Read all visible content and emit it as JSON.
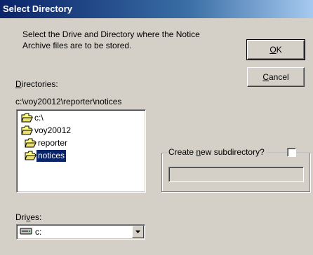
{
  "window": {
    "title": "Select Directory"
  },
  "instructions": {
    "line1": "Select the Drive and Directory where the Notice",
    "line2": "Archive files are to be stored."
  },
  "buttons": {
    "ok": {
      "pre": "",
      "key": "O",
      "post": "K"
    },
    "cancel": {
      "pre": "",
      "key": "C",
      "post": "ancel"
    }
  },
  "directories": {
    "label": {
      "pre": "",
      "key": "D",
      "post": "irectories:"
    },
    "current_path": "c:\\voy20012\\reporter\\notices",
    "tree": [
      {
        "label": "c:\\",
        "icon": "open-folder-icon",
        "selected": false
      },
      {
        "label": "voy20012",
        "icon": "open-folder-icon",
        "selected": false
      },
      {
        "label": "reporter",
        "icon": "open-folder-icon",
        "selected": false
      },
      {
        "label": "notices",
        "icon": "open-folder-icon",
        "selected": true
      }
    ]
  },
  "subdirectory": {
    "label": {
      "pre": "Create ",
      "key": "n",
      "post": "ew subdirectory?"
    },
    "checked": false,
    "value": ""
  },
  "drives": {
    "label": {
      "pre": "Dri",
      "key": "v",
      "post": "es:"
    },
    "selected": "c:",
    "icon": "drive-icon"
  }
}
